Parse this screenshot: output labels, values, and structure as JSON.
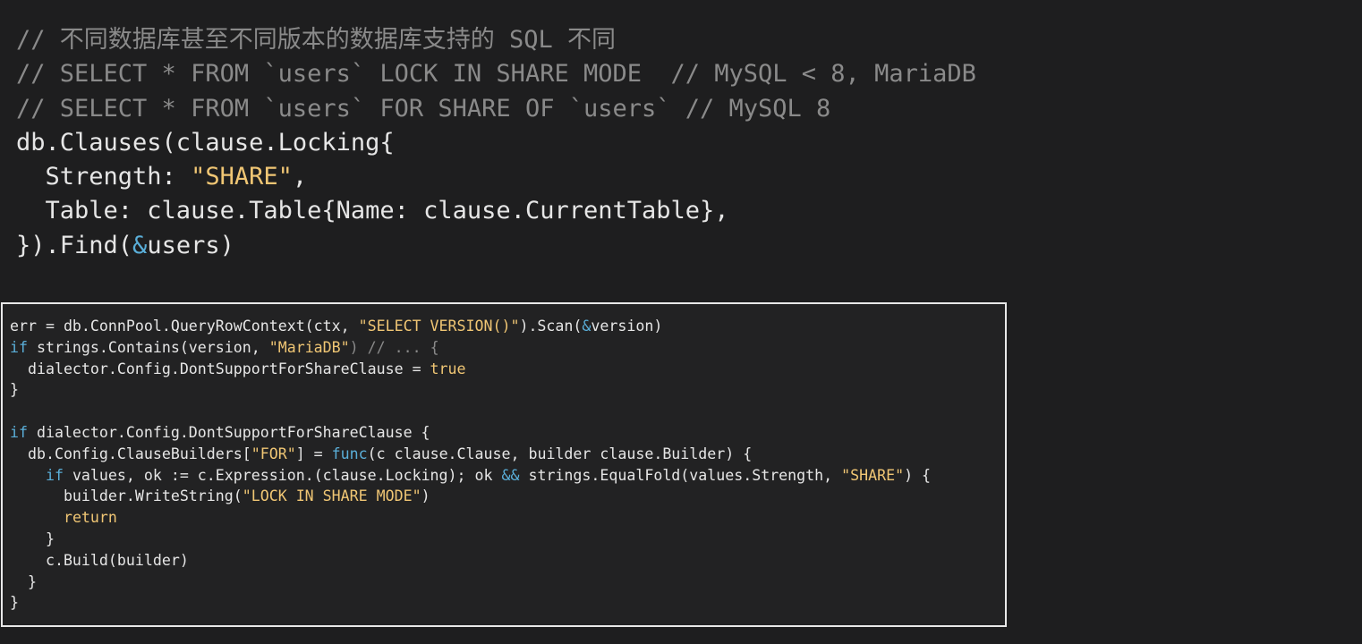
{
  "top_code": {
    "lines": [
      [
        {
          "t": "// 不同数据库甚至不同版本的数据库支持的 SQL 不同",
          "c": "comment"
        }
      ],
      [
        {
          "t": "// SELECT * FROM `users` LOCK IN SHARE MODE  // MySQL < 8, MariaDB",
          "c": "comment"
        }
      ],
      [
        {
          "t": "// SELECT * FROM `users` FOR SHARE OF `users` // MySQL 8",
          "c": "comment"
        }
      ],
      [
        {
          "t": "db.Clauses(clause.Locking{",
          "c": "plain"
        }
      ],
      [
        {
          "t": "  Strength: ",
          "c": "plain"
        },
        {
          "t": "\"SHARE\"",
          "c": "string"
        },
        {
          "t": ",",
          "c": "plain"
        }
      ],
      [
        {
          "t": "  Table: clause.Table{Name: clause.CurrentTable},",
          "c": "plain"
        }
      ],
      [
        {
          "t": "}).Find(",
          "c": "plain"
        },
        {
          "t": "&",
          "c": "keyword"
        },
        {
          "t": "users)",
          "c": "plain"
        }
      ]
    ]
  },
  "box_code": {
    "lines": [
      [
        {
          "t": "err = db.ConnPool.QueryRowContext(ctx, ",
          "c": "plain"
        },
        {
          "t": "\"SELECT VERSION()\"",
          "c": "string"
        },
        {
          "t": ").Scan(",
          "c": "plain"
        },
        {
          "t": "&",
          "c": "keyword"
        },
        {
          "t": "version)",
          "c": "plain"
        }
      ],
      [
        {
          "t": "if",
          "c": "keyword"
        },
        {
          "t": " strings.Contains(version, ",
          "c": "plain"
        },
        {
          "t": "\"MariaDB\"",
          "c": "string"
        },
        {
          "t": ") // ... {",
          "c": "comment"
        }
      ],
      [
        {
          "t": "  dialector.Config.DontSupportForShareClause = ",
          "c": "plain"
        },
        {
          "t": "true",
          "c": "boolean"
        }
      ],
      [
        {
          "t": "}",
          "c": "plain"
        }
      ],
      [
        {
          "t": "",
          "c": "plain"
        }
      ],
      [
        {
          "t": "if",
          "c": "keyword"
        },
        {
          "t": " dialector.Config.DontSupportForShareClause {",
          "c": "plain"
        }
      ],
      [
        {
          "t": "  db.Config.ClauseBuilders[",
          "c": "plain"
        },
        {
          "t": "\"FOR\"",
          "c": "string"
        },
        {
          "t": "] = ",
          "c": "plain"
        },
        {
          "t": "func",
          "c": "keyword"
        },
        {
          "t": "(c clause.Clause, builder clause.Builder) {",
          "c": "plain"
        }
      ],
      [
        {
          "t": "    ",
          "c": "plain"
        },
        {
          "t": "if",
          "c": "keyword"
        },
        {
          "t": " values, ok := c.Expression.(clause.Locking); ok ",
          "c": "plain"
        },
        {
          "t": "&&",
          "c": "keyword"
        },
        {
          "t": " strings.EqualFold(values.Strength, ",
          "c": "plain"
        },
        {
          "t": "\"SHARE\"",
          "c": "string"
        },
        {
          "t": ") {",
          "c": "plain"
        }
      ],
      [
        {
          "t": "      builder.WriteString(",
          "c": "plain"
        },
        {
          "t": "\"LOCK IN SHARE MODE\"",
          "c": "string"
        },
        {
          "t": ")",
          "c": "plain"
        }
      ],
      [
        {
          "t": "      ",
          "c": "plain"
        },
        {
          "t": "return",
          "c": "boolean"
        }
      ],
      [
        {
          "t": "    }",
          "c": "plain"
        }
      ],
      [
        {
          "t": "    c.Build(builder)",
          "c": "plain"
        }
      ],
      [
        {
          "t": "  }",
          "c": "plain"
        }
      ],
      [
        {
          "t": "}",
          "c": "plain"
        }
      ]
    ]
  },
  "colors": {
    "background": "#1e1e1f",
    "comment": "#8a8a8a",
    "string": "#f0c674",
    "keyword": "#5aaed8",
    "plain": "#e6e6e6",
    "box_border": "#e8e8e8"
  }
}
